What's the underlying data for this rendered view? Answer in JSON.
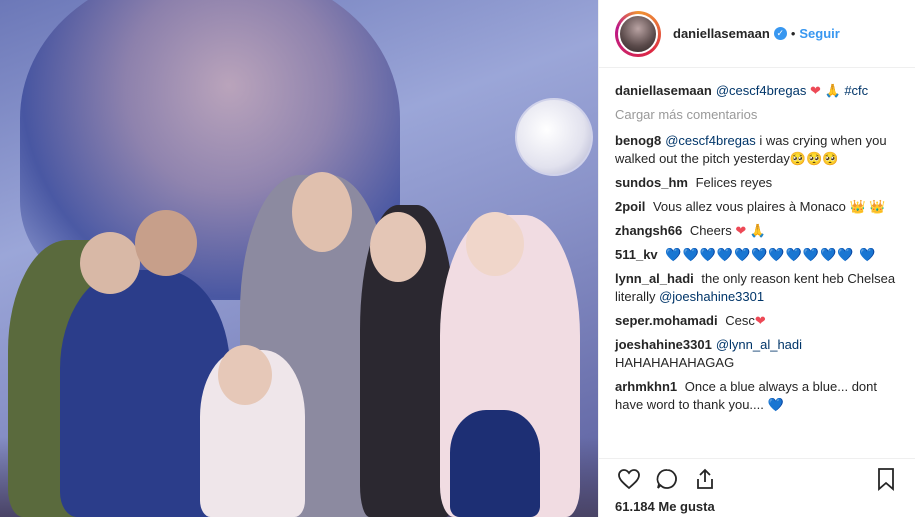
{
  "header": {
    "username": "daniellasemaan",
    "separator": "•",
    "follow_label": "Seguir"
  },
  "caption": {
    "user": "daniellasemaan",
    "mention": "@cescf4bregas",
    "hashtag": "#cfc"
  },
  "load_more": "Cargar más comentarios",
  "comments": [
    {
      "user": "benog8",
      "mention": "@cescf4bregas",
      "text": "i was crying when you walked out the pitch yesterday🥺🥺🥺"
    },
    {
      "user": "sundos_hm",
      "text": "Felices reyes"
    },
    {
      "user": "2poil",
      "text": "Vous allez vous plaires à Monaco"
    },
    {
      "user": "zhangsh66",
      "text": "Cheers"
    },
    {
      "user": "511_kv",
      "text": ""
    },
    {
      "user": "lynn_al_hadi",
      "text": "the only reason kent heb Chelsea literally",
      "mention": "@joeshahine3301"
    },
    {
      "user": "seper.mohamadi",
      "text": "Cesc"
    },
    {
      "user": "joeshahine3301",
      "mention": "@lynn_al_hadi",
      "text": "HAHAHAHAHAGAG"
    },
    {
      "user": "arhmkhn1",
      "text": "Once a blue always a blue... dont have word to thank you...."
    }
  ],
  "likes": "61.184 Me gusta",
  "icons": {
    "verified": "verified-badge-icon",
    "like": "heart-outline-icon",
    "comment": "comment-bubble-icon",
    "share": "share-upload-icon",
    "save": "bookmark-icon"
  },
  "colors": {
    "link_blue": "#3897f0",
    "heart_red": "#ed4956",
    "blue_heart": "#1ab2e6"
  }
}
